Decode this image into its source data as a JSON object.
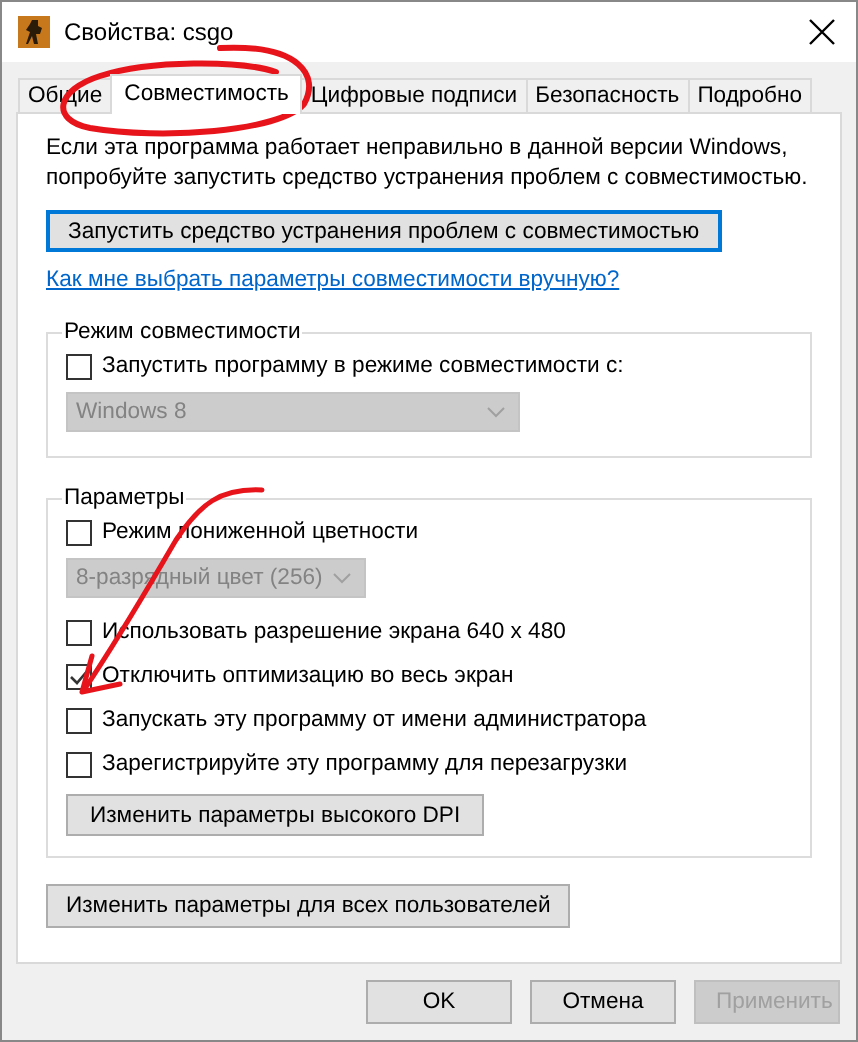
{
  "window": {
    "title": "Свойства: csgo"
  },
  "tabs": [
    {
      "label": "Общие",
      "selected": false
    },
    {
      "label": "Совместимость",
      "selected": true
    },
    {
      "label": "Цифровые подписи",
      "selected": false
    },
    {
      "label": "Безопасность",
      "selected": false
    },
    {
      "label": "Подробно",
      "selected": false
    }
  ],
  "intro": "Если эта программа работает неправильно в данной версии Windows, попробуйте запустить средство устранения проблем с совместимостью.",
  "troubleshoot_button": {
    "label": "Запустить средство устранения проблем с совместимостью",
    "focused": true
  },
  "help_link": "Как мне выбрать параметры совместимости вручную?",
  "groups": [
    {
      "title": "Режим совместимости",
      "items": [
        {
          "kind": "checkbox",
          "label": "Запустить программу в режиме совместимости с:",
          "checked": false
        },
        {
          "kind": "dropdown",
          "value": "Windows 8",
          "disabled": true
        }
      ]
    },
    {
      "title": "Параметры",
      "items": [
        {
          "kind": "checkbox",
          "label": "Режим пониженной цветности",
          "checked": false
        },
        {
          "kind": "dropdown",
          "value": "8-разрядный цвет (256)",
          "disabled": true
        },
        {
          "kind": "checkbox",
          "label": "Использовать разрешение экрана 640 x 480",
          "checked": false
        },
        {
          "kind": "checkbox",
          "label": "Отключить оптимизацию во весь экран",
          "checked": true
        },
        {
          "kind": "checkbox",
          "label": "Запускать эту программу от имени администратора",
          "checked": false
        },
        {
          "kind": "checkbox",
          "label": "Зарегистрируйте эту программу для перезагрузки",
          "checked": false
        },
        {
          "kind": "button",
          "label": "Изменить параметры высокого DPI"
        }
      ]
    }
  ],
  "all_users_button": "Изменить параметры для всех пользователей",
  "footer_buttons": [
    {
      "label": "OK",
      "disabled": false
    },
    {
      "label": "Отмена",
      "disabled": false
    },
    {
      "label": "Применить",
      "disabled": true
    }
  ],
  "annotations": [
    {
      "kind": "ellipse"
    },
    {
      "kind": "arrow"
    }
  ]
}
